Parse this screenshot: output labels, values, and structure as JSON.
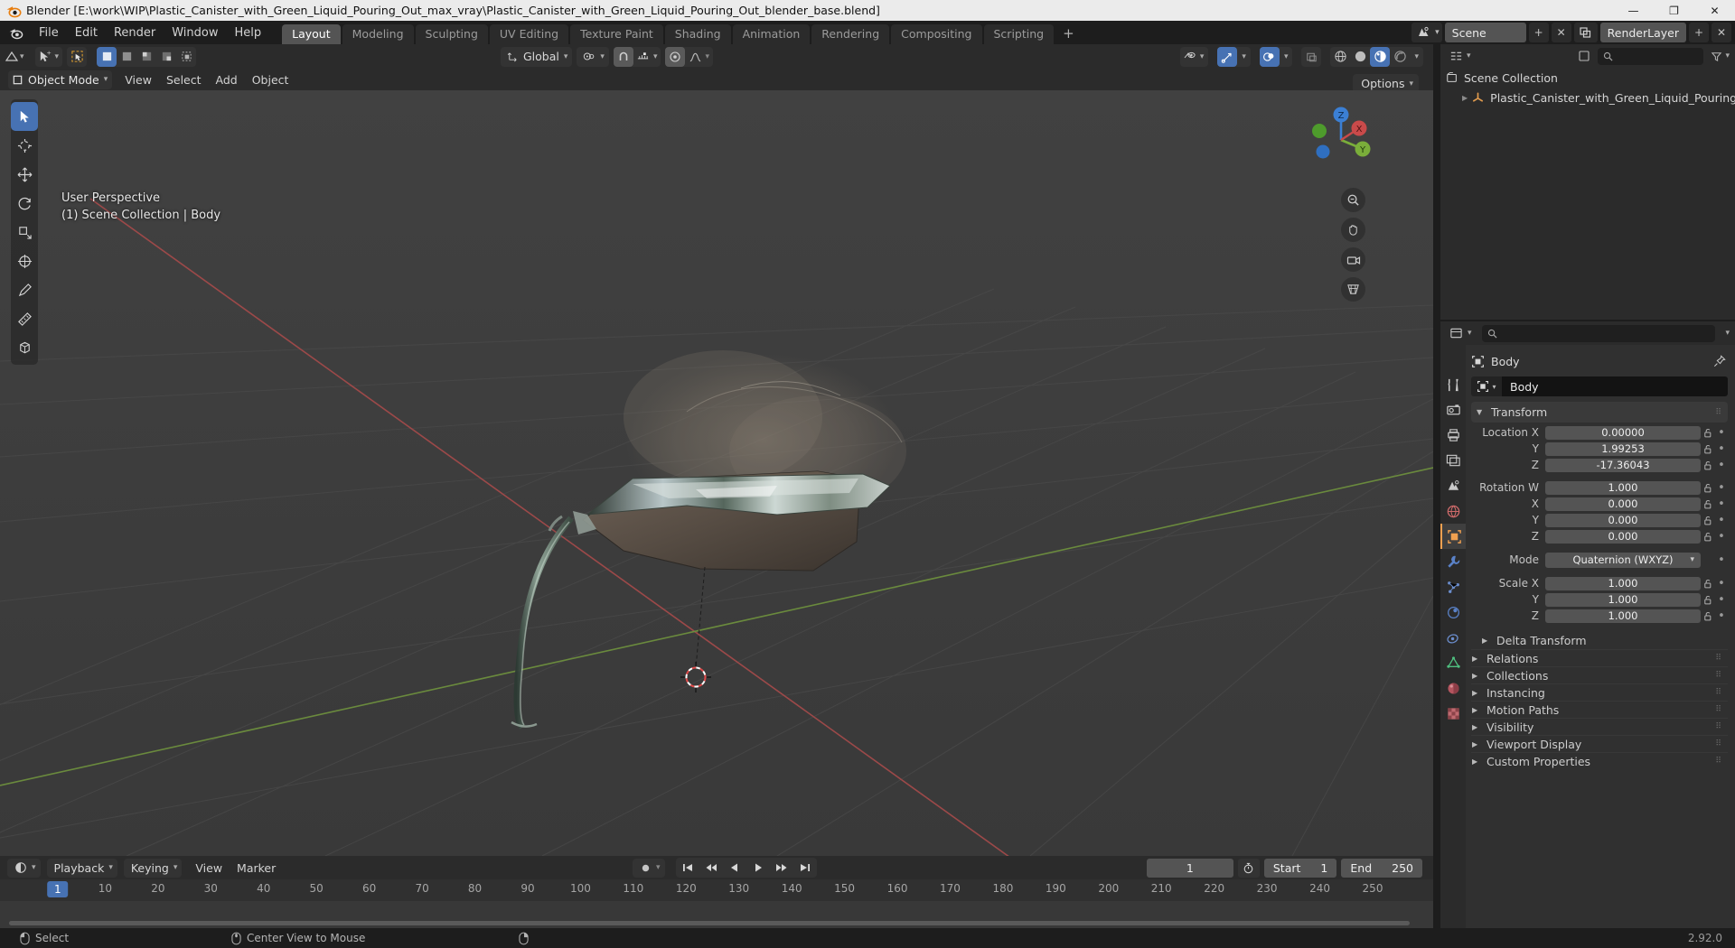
{
  "window": {
    "title": "Blender [E:\\work\\WIP\\Plastic_Canister_with_Green_Liquid_Pouring_Out_max_vray\\Plastic_Canister_with_Green_Liquid_Pouring_Out_blender_base.blend]",
    "minimize": "—",
    "maximize": "❐",
    "close": "✕"
  },
  "menubar": {
    "items": [
      "File",
      "Edit",
      "Render",
      "Window",
      "Help"
    ]
  },
  "workspaces": {
    "tabs": [
      "Layout",
      "Modeling",
      "Sculpting",
      "UV Editing",
      "Texture Paint",
      "Shading",
      "Animation",
      "Rendering",
      "Compositing",
      "Scripting"
    ],
    "active": "Layout",
    "add": "+"
  },
  "topright": {
    "scene_name": "Scene",
    "viewlayer_name": "RenderLayer",
    "new_scene": "+",
    "unlink_scene": "✕",
    "new_layer": "+",
    "remove_layer": "✕"
  },
  "viewport_header": {
    "transform_orientation": "Global",
    "proportional_falloff": "",
    "options_label": "Options"
  },
  "viewport_row2": {
    "mode": "Object Mode",
    "menus": [
      "View",
      "Select",
      "Add",
      "Object"
    ]
  },
  "viewport": {
    "overlay_line1": "User Perspective",
    "overlay_line2": "(1) Scene Collection | Body",
    "gizmo_axes": {
      "z": "Z",
      "y": "Y",
      "x": "X"
    }
  },
  "timeline": {
    "playback": "Playback",
    "keying": "Keying",
    "view": "View",
    "marker": "Marker",
    "current_frame": "1",
    "start_label": "Start",
    "start_value": "1",
    "end_label": "End",
    "end_value": "250",
    "playhead_label": "1",
    "ticks": [
      "10",
      "20",
      "30",
      "40",
      "50",
      "60",
      "70",
      "80",
      "90",
      "100",
      "110",
      "120",
      "130",
      "140",
      "150",
      "160",
      "170",
      "180",
      "190",
      "200",
      "210",
      "220",
      "230",
      "240",
      "250"
    ]
  },
  "outliner": {
    "filter_placeholder": "",
    "rows": [
      {
        "label": "Scene Collection",
        "icon": "collection-icon",
        "depth": 0,
        "selected": false
      },
      {
        "label": "Plastic_Canister_with_Green_Liquid_Pouring",
        "icon": "empty-axis-icon",
        "depth": 1,
        "selected": false
      }
    ]
  },
  "properties": {
    "breadcrumb_object": "Body",
    "object_name_value": "Body",
    "transform": {
      "title": "Transform",
      "rows": [
        {
          "label": "Location X",
          "value": "0.00000"
        },
        {
          "label": "Y",
          "value": "1.99253"
        },
        {
          "label": "Z",
          "value": "-17.36043"
        }
      ],
      "rotation": [
        {
          "label": "Rotation W",
          "value": "1.000"
        },
        {
          "label": "X",
          "value": "0.000"
        },
        {
          "label": "Y",
          "value": "0.000"
        },
        {
          "label": "Z",
          "value": "0.000"
        }
      ],
      "mode_label": "Mode",
      "mode_value": "Quaternion (WXYZ)",
      "scale": [
        {
          "label": "Scale X",
          "value": "1.000"
        },
        {
          "label": "Y",
          "value": "1.000"
        },
        {
          "label": "Z",
          "value": "1.000"
        }
      ]
    },
    "sub_panel": "Delta Transform",
    "collapsed_panels": [
      "Relations",
      "Collections",
      "Instancing",
      "Motion Paths",
      "Visibility",
      "Viewport Display",
      "Custom Properties"
    ]
  },
  "statusbar": {
    "items": [
      {
        "icon": "mouse-left-icon",
        "label": "Select"
      },
      {
        "icon": "mouse-middle-icon",
        "label": "Center View to Mouse"
      },
      {
        "icon": "mouse-right-icon",
        "label": ""
      }
    ],
    "version": "2.92.0"
  },
  "colors": {
    "accent_blue": "#4772b3",
    "active_orange": "#f0a050",
    "axis_x_red": "#9e4martin",
    "axis_red": "#a33f3f",
    "axis_green": "#5d8a3a",
    "panel_bg": "#303030",
    "header_bg": "#2b2b2b"
  }
}
